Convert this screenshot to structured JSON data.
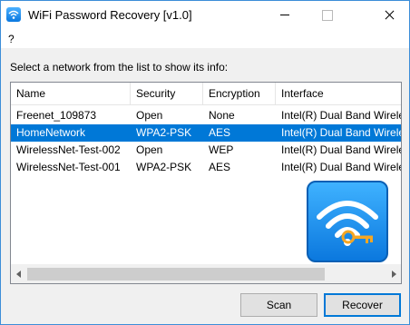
{
  "window": {
    "title": "WiFi Password Recovery [v1.0]"
  },
  "menu": {
    "help_label": "?"
  },
  "instructions": "Select a network from the list to show its info:",
  "list": {
    "columns": [
      "Name",
      "Security",
      "Encryption",
      "Interface"
    ],
    "rows": [
      {
        "name": "Freenet_109873",
        "security": "Open",
        "encryption": "None",
        "interface": "Intel(R) Dual Band Wireless"
      },
      {
        "name": "HomeNetwork",
        "security": "WPA2-PSK",
        "encryption": "AES",
        "interface": "Intel(R) Dual Band Wireless"
      },
      {
        "name": "WirelessNet-Test-002",
        "security": "Open",
        "encryption": "WEP",
        "interface": "Intel(R) Dual Band Wireless"
      },
      {
        "name": "WirelessNet-Test-001",
        "security": "WPA2-PSK",
        "encryption": "AES",
        "interface": "Intel(R) Dual Band Wireless"
      }
    ],
    "selected_row": 1
  },
  "buttons": {
    "scan": "Scan",
    "recover": "Recover"
  },
  "icons": {
    "app": "wifi-key-icon",
    "logo": "wifi-key-logo"
  },
  "colors": {
    "selection": "#0078d7",
    "logo_blue": "#1e90f0",
    "key_orange": "#f5a623"
  }
}
